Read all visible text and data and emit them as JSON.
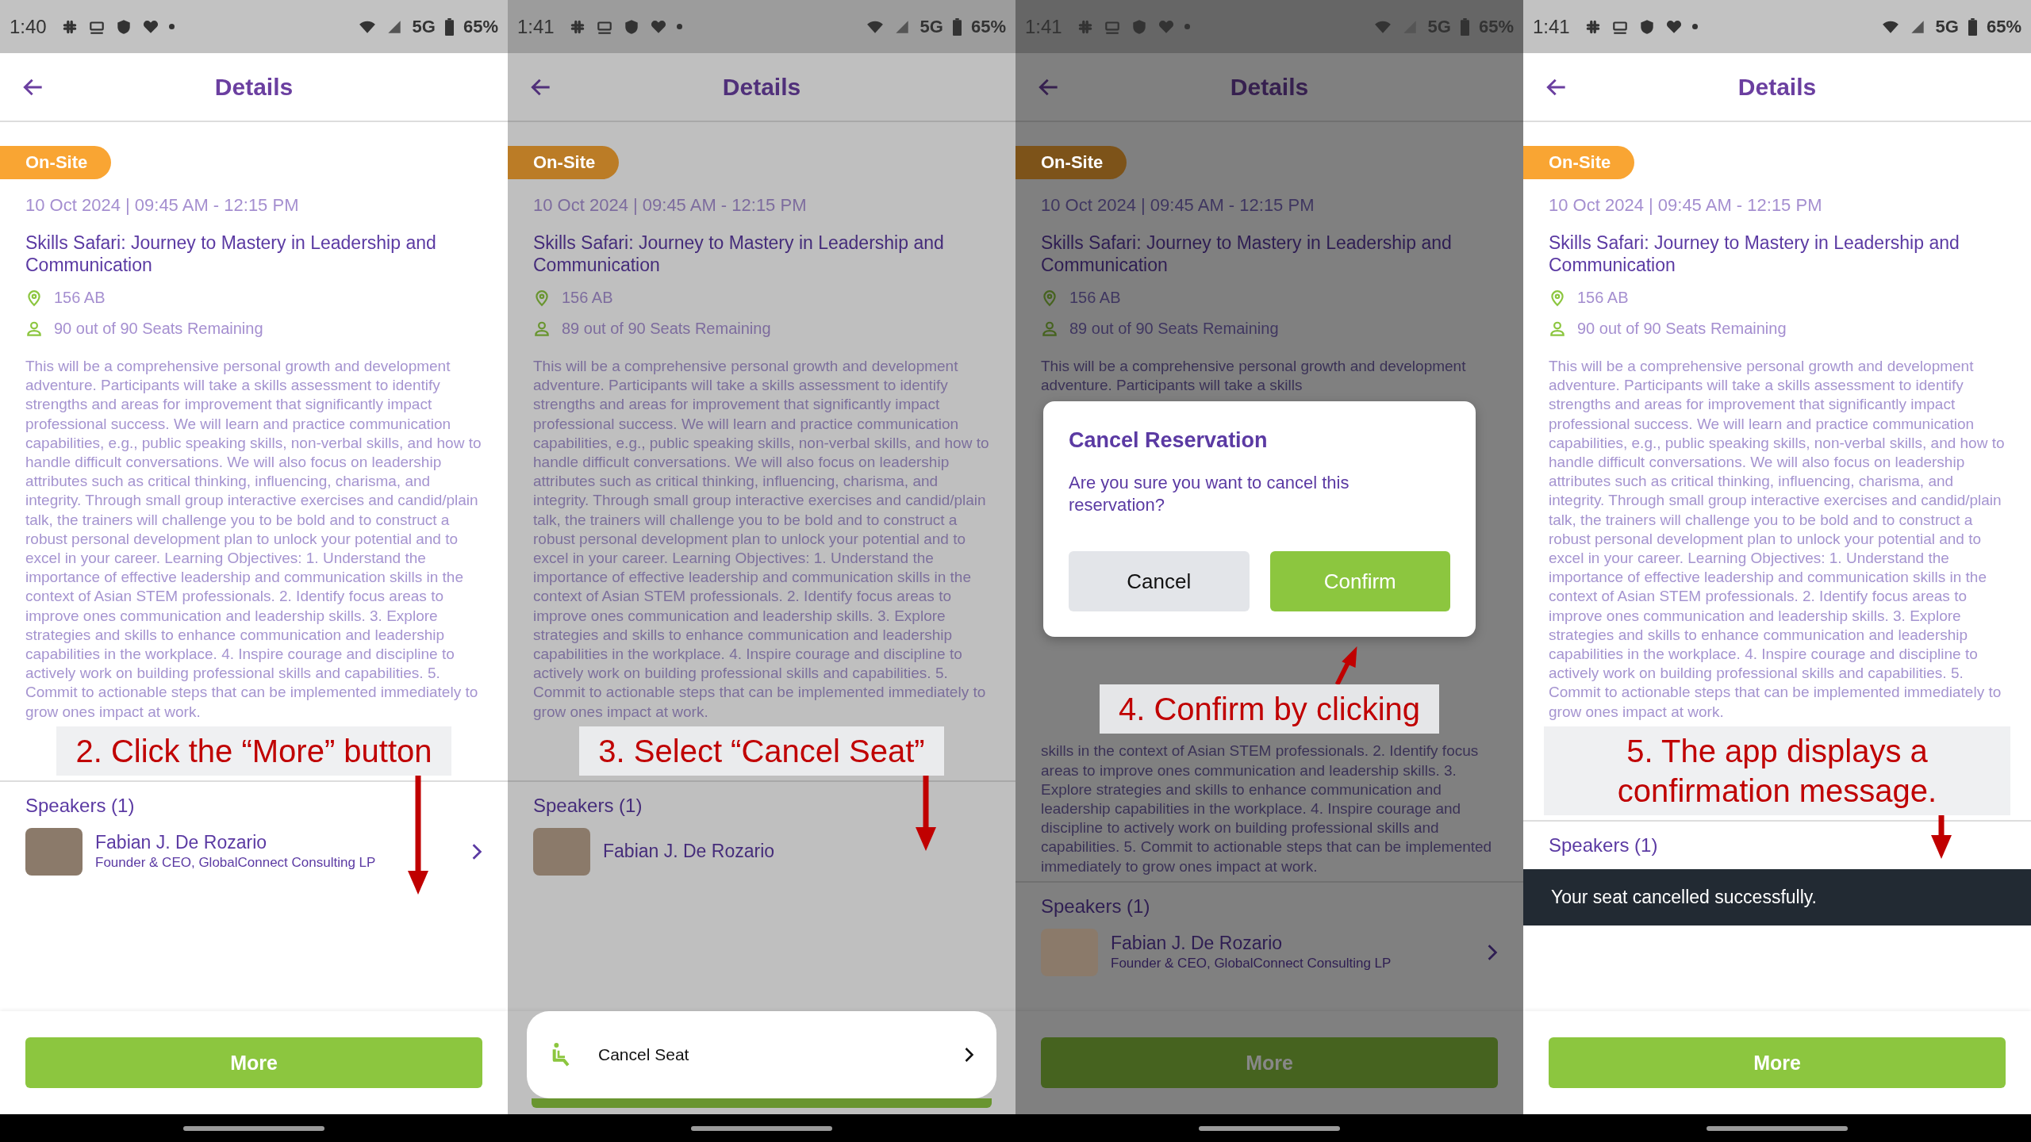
{
  "panels": [
    {
      "status_bar": {
        "time": "1:40",
        "network": "5G",
        "battery": "65%"
      },
      "header": {
        "title": "Details"
      },
      "badge": "On-Site",
      "date": "10 Oct 2024 | 09:45 AM - 12:15 PM",
      "title": "Skills Safari: Journey to Mastery in Leadership and Communication",
      "location": "156 AB",
      "seats": "90 out of 90 Seats Remaining",
      "description": "This will be a comprehensive personal growth and development adventure. Participants will take a skills assessment to identify strengths and areas for improvement that significantly impact professional success. We will learn and practice communication capabilities, e.g., public speaking skills, non-verbal skills, and how to handle difficult conversations. We will also focus on leadership attributes such as critical thinking, influencing, charisma, and integrity. Through small group interactive exercises and candid/plain talk, the trainers will challenge you to be bold and to construct a robust personal development plan to unlock your potential and to excel in your career. Learning Objectives: 1. Understand the importance of effective leadership and communication skills in the context of Asian STEM professionals. 2. Identify focus areas to improve ones communication and leadership skills. 3. Explore strategies and skills to enhance communication and leadership capabilities in the workplace. 4. Inspire courage and discipline to actively work on building professional skills and capabilities. 5. Commit to actionable steps that can be implemented immediately to grow ones impact at work.",
      "annotation": {
        "text": "2. Click the “More” button"
      },
      "speakers_heading": "Speakers (1)",
      "speaker": {
        "name": "Fabian J. De Rozario",
        "role": "Founder & CEO, GlobalConnect Consulting LP"
      },
      "overlay": {
        "kind": "none"
      },
      "more_button": "More"
    },
    {
      "status_bar": {
        "time": "1:41",
        "network": "5G",
        "battery": "65%"
      },
      "header": {
        "title": "Details"
      },
      "badge": "On-Site",
      "date": "10 Oct 2024 | 09:45 AM - 12:15 PM",
      "title": "Skills Safari: Journey to Mastery in Leadership and Communication",
      "location": "156 AB",
      "seats": "89 out of 90 Seats Remaining",
      "description": "This will be a comprehensive personal growth and development adventure. Participants will take a skills assessment to identify strengths and areas for improvement that significantly impact professional success. We will learn and practice communication capabilities, e.g., public speaking skills, non-verbal skills, and how to handle difficult conversations. We will also focus on leadership attributes such as critical thinking, influencing, charisma, and integrity. Through small group interactive exercises and candid/plain talk, the trainers will challenge you to be bold and to construct a robust personal development plan to unlock your potential and to excel in your career. Learning Objectives: 1. Understand the importance of effective leadership and communication skills in the context of Asian STEM professionals. 2. Identify focus areas to improve ones communication and leadership skills. 3. Explore strategies and skills to enhance communication and leadership capabilities in the workplace. 4. Inspire courage and discipline to actively work on building professional skills and capabilities. 5. Commit to actionable steps that can be implemented immediately to grow ones impact at work.",
      "annotation": {
        "text": "3. Select “Cancel Seat”"
      },
      "speakers_heading": "Speakers (1)",
      "speaker": {
        "name": "Fabian J. De Rozario"
      },
      "overlay": {
        "kind": "sheet",
        "label": "Cancel Seat"
      }
    },
    {
      "status_bar": {
        "time": "1:41",
        "network": "5G",
        "battery": "65%"
      },
      "header": {
        "title": "Details"
      },
      "badge": "On-Site",
      "date": "10 Oct 2024 | 09:45 AM - 12:15 PM",
      "title": "Skills Safari: Journey to Mastery in Leadership and Communication",
      "location": "156 AB",
      "seats": "89 out of 90 Seats Remaining",
      "description": "This will be a comprehensive personal growth and development adventure. Participants will take a skills",
      "description_below": "skills in the context of Asian STEM professionals. 2. Identify focus areas to improve ones communication and leadership skills. 3. Explore strategies and skills to enhance communication and leadership capabilities in the workplace. 4. Inspire courage and discipline to actively work on building professional skills and capabilities. 5. Commit to actionable steps that can be implemented immediately to grow ones impact at work.",
      "annotation": {
        "text": "4. Confirm by clicking"
      },
      "speakers_heading": "Speakers (1)",
      "speaker": {
        "name": "Fabian J. De Rozario",
        "role": "Founder & CEO, GlobalConnect Consulting LP"
      },
      "overlay": {
        "kind": "dialog",
        "title": "Cancel Reservation",
        "message": "Are you sure you want to cancel this reservation?",
        "cancel": "Cancel",
        "confirm": "Confirm"
      },
      "more_button": "More"
    },
    {
      "status_bar": {
        "time": "1:41",
        "network": "5G",
        "battery": "65%"
      },
      "header": {
        "title": "Details"
      },
      "badge": "On-Site",
      "date": "10 Oct 2024 | 09:45 AM - 12:15 PM",
      "title": "Skills Safari: Journey to Mastery in Leadership and Communication",
      "location": "156 AB",
      "seats": "90 out of 90 Seats Remaining",
      "description": "This will be a comprehensive personal growth and development adventure. Participants will take a skills assessment to identify strengths and areas for improvement that significantly impact professional success. We will learn and practice communication capabilities, e.g., public speaking skills, non-verbal skills, and how to handle difficult conversations. We will also focus on leadership attributes such as critical thinking, influencing, charisma, and integrity. Through small group interactive exercises and candid/plain talk, the trainers will challenge you to be bold and to construct a robust personal development plan to unlock your potential and to excel in your career. Learning Objectives: 1. Understand the importance of effective leadership and communication skills in the context of Asian STEM professionals. 2. Identify focus areas to improve ones communication and leadership skills. 3. Explore strategies and skills to enhance communication and leadership capabilities in the workplace. 4. Inspire courage and discipline to actively work on building professional skills and capabilities. 5. Commit to actionable steps that can be implemented immediately to grow ones impact at work.",
      "annotation": {
        "text": "5. The app displays a confirmation message."
      },
      "speakers_heading": "Speakers (1)",
      "overlay": {
        "kind": "toast",
        "message": "Your seat cancelled successfully."
      },
      "more_button": "More"
    }
  ]
}
